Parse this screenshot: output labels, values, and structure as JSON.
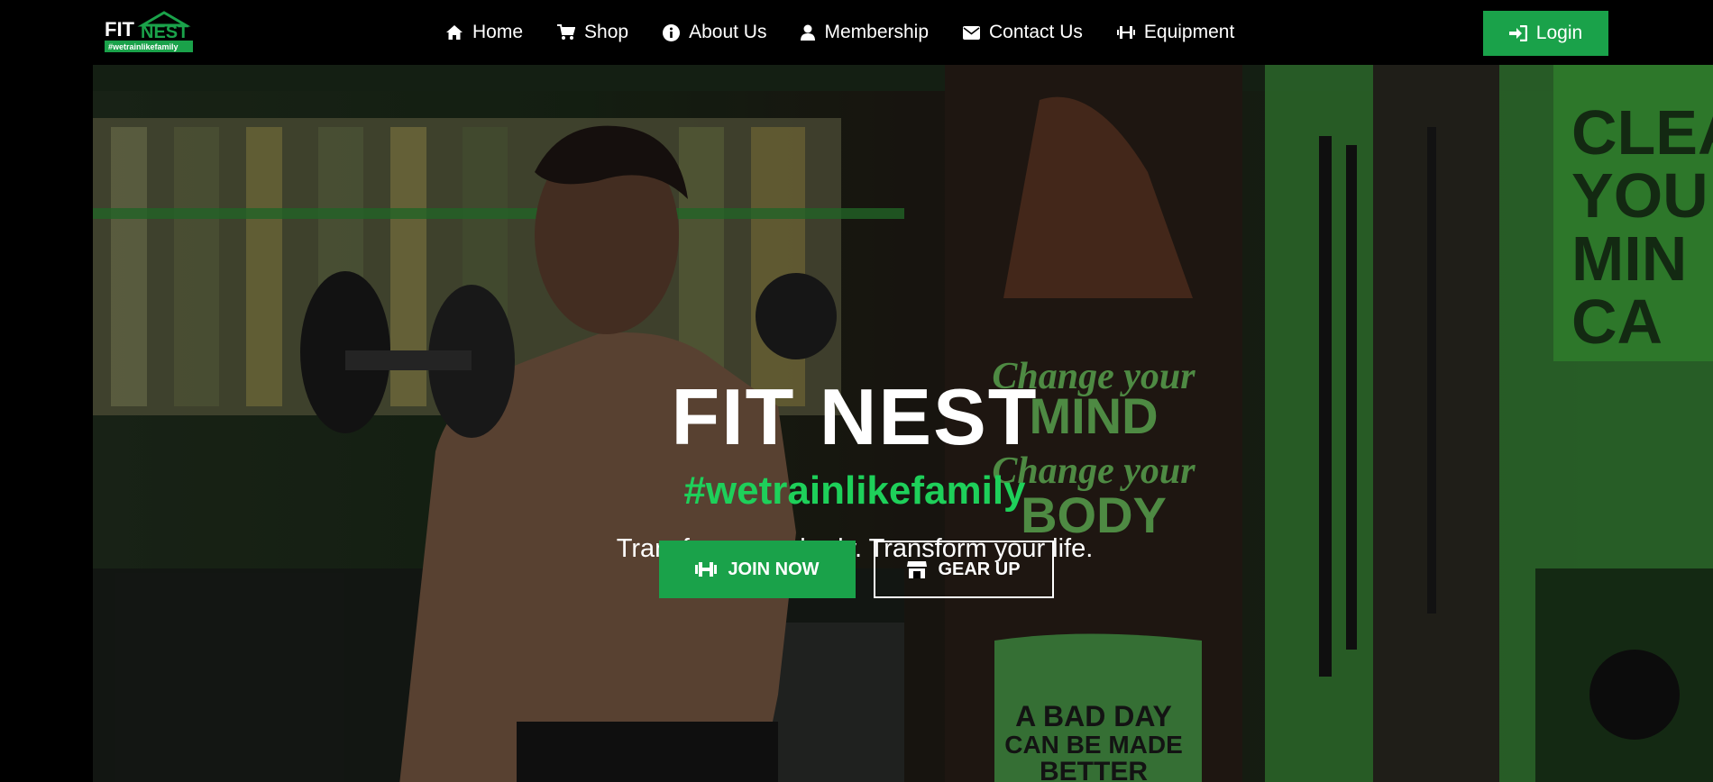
{
  "nav": {
    "logo": {
      "line1": "FIT",
      "line2": "NEST",
      "tag": "#wetrainlikefamily"
    },
    "items": [
      {
        "label": "Home",
        "icon": "home-icon"
      },
      {
        "label": "Shop",
        "icon": "cart-icon"
      },
      {
        "label": "About Us",
        "icon": "info-icon"
      },
      {
        "label": "Membership",
        "icon": "user-icon"
      },
      {
        "label": "Contact Us",
        "icon": "envelope-icon"
      },
      {
        "label": "Equipment",
        "icon": "dumbbell-icon"
      }
    ],
    "login_label": "Login"
  },
  "hero": {
    "title": "FIT NEST",
    "tagline": "#wetrainlikefamily",
    "subtitle": "Transform your body. Transform your life.",
    "join_label": "JOIN NOW",
    "gear_label": "GEAR UP",
    "poster_text": {
      "change_mind_1": "Change your",
      "change_mind_2": "MIND",
      "change_body_1": "Change your",
      "change_body_2": "BODY",
      "bad_day_1": "A BAD DAY",
      "bad_day_2": "CAN BE MADE",
      "bad_day_3": "BETTER",
      "wall_1": "CLEA",
      "wall_2": "YOU",
      "wall_3": "MIN",
      "wall_4": "CA"
    }
  },
  "colors": {
    "accent": "#1aa24a",
    "tagline": "#1ed05a",
    "background": "#000000"
  }
}
